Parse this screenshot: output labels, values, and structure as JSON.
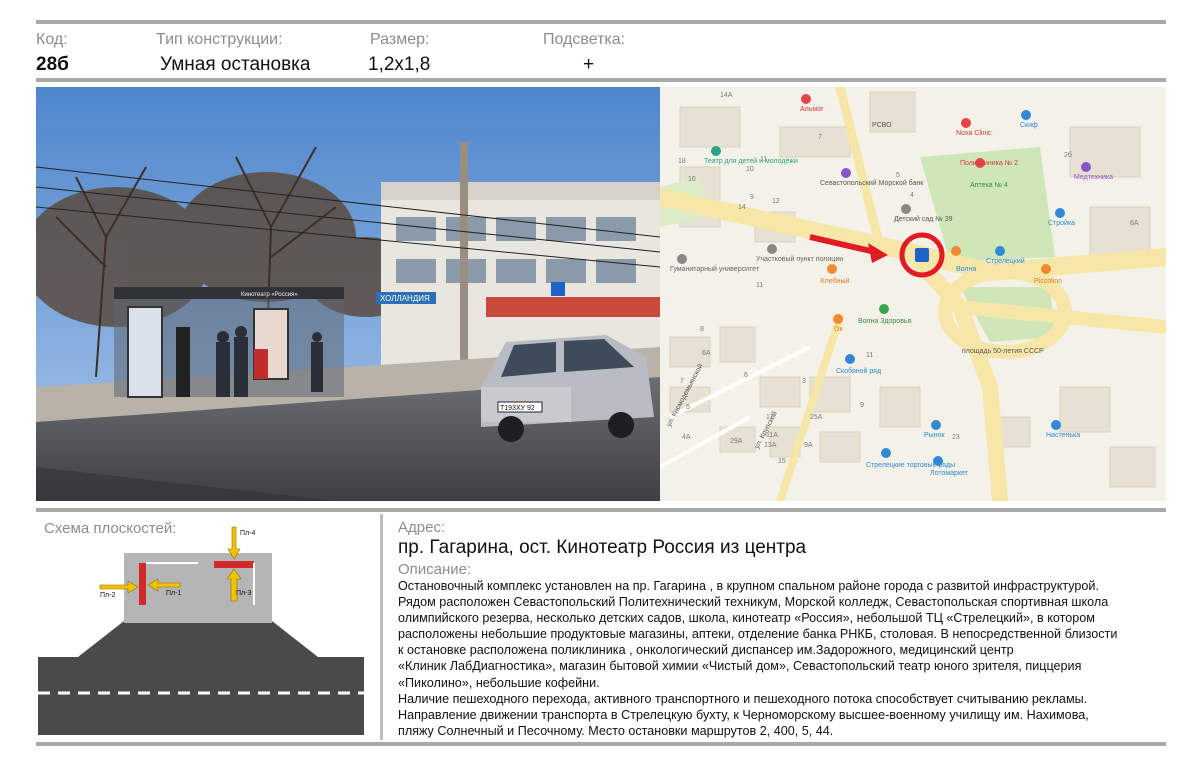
{
  "header": {
    "code_label": "Код:",
    "code_value": "28б",
    "type_label": "Тип конструкции:",
    "type_value": "Умная остановка",
    "size_label": "Размер:",
    "size_value": "1,2х1,8",
    "light_label": "Подсветка:",
    "light_value": "+"
  },
  "photo": {
    "stop_sign": "Кинотеатр «Россия»",
    "shop_sign": "ХОЛЛАНДИЯ",
    "plate": "Т193ХУ 92"
  },
  "map": {
    "labels": {
      "almog": "Альмог",
      "rsvo": "РСВО",
      "nova_clinic": "Nova Clinic",
      "skif": "Скиф",
      "theatre": "Театр для детей и молодёжи",
      "polyclinic": "Поликлиника № 2",
      "apteka": "Аптека № 4",
      "medtechnika": "Медтехника",
      "bank": "Севастопольский Морской банк",
      "kindergarten": "Детский сад № 39",
      "stroyka": "Стройка",
      "police": "Участковый пункт полиции",
      "university": "Гуманитарный университет",
      "volna": "Волна",
      "streletsky": "Стрелецкий",
      "piccolino": "Piccolino",
      "khlebny": "Хлебный",
      "volna_health": "Волна Здоровья",
      "ok": "Ок",
      "square": "площадь 50-летия СССР",
      "skobyanoy": "Скобяной ряд",
      "kosmodemyanskoy": "ул. Космодемьянской",
      "krupskoy": "ул. Крупской",
      "rynok": "Рынок",
      "nastenka": "Настенька",
      "streletsky_rows": "Стрелецкие торговые ряды",
      "lotomarket": "Лотомаркет"
    },
    "house_numbers": [
      "14А",
      "11",
      "10",
      "9",
      "7",
      "5",
      "4",
      "2б",
      "6А",
      "18",
      "16",
      "14",
      "12",
      "11",
      "8",
      "6А",
      "7",
      "6",
      "5",
      "3",
      "4А",
      "29А",
      "25А",
      "17",
      "15",
      "13А",
      "11А",
      "9А",
      "9",
      "11",
      "23"
    ],
    "colors": {
      "road": "#f6e7a8",
      "park": "#cfe7b8",
      "marker": "#e21b23",
      "arrow": "#e21b23"
    }
  },
  "scheme": {
    "title": "Схема плоскостей:",
    "planes": [
      "Пл-1",
      "Пл-2",
      "Пл-3",
      "Пл-4"
    ],
    "colors": {
      "plane": "#d22a2a",
      "arrow": "#f2c200",
      "road": "#4a4a4a",
      "island": "#b5b5b5"
    }
  },
  "address": {
    "label": "Адрес:",
    "value": "пр. Гагарина, ост. Кинотеатр Россия из центра"
  },
  "description": {
    "label": "Описание:",
    "lines": [
      "Остановочный комплекс установлен на пр. Гагарина , в крупном спальном районе города  с развитой инфраструктурой.",
      "Рядом расположен Севастопольский Политехнический техникум,  Морской колледж,  Севастопольская спортивная школа",
      "олимпийского резерва,  несколько детских садов, школа, кинотеатр «Россия», небольшой  ТЦ «Стрелецкий», в котором",
      "расположены небольшие продуктовые магазины, аптеки, отделение банка РНКБ, столовая. В непосредственной близости",
      "к остановке расположена поликлиника , онкологический диспансер им.Задорожного, медицинский центр",
      "«Клиник ЛабДиагностика», магазин бытовой химии «Чистый дом»,  Севастопольский театр юного зрителя, пиццерия",
      "«Пиколино», небольшие кофейни.",
      " Наличие пешеходного перехода, активного транспортного и пешеходного потока способствует  считыванию рекламы.",
      "Направление движении транспорта в Стрелецкую бухту, к  Черноморскому высшее-военному училищу им. Нахимова,",
      "пляжу Солнечный и Песочному.  Место остановки маршрутов 2, 400, 5, 44."
    ]
  }
}
